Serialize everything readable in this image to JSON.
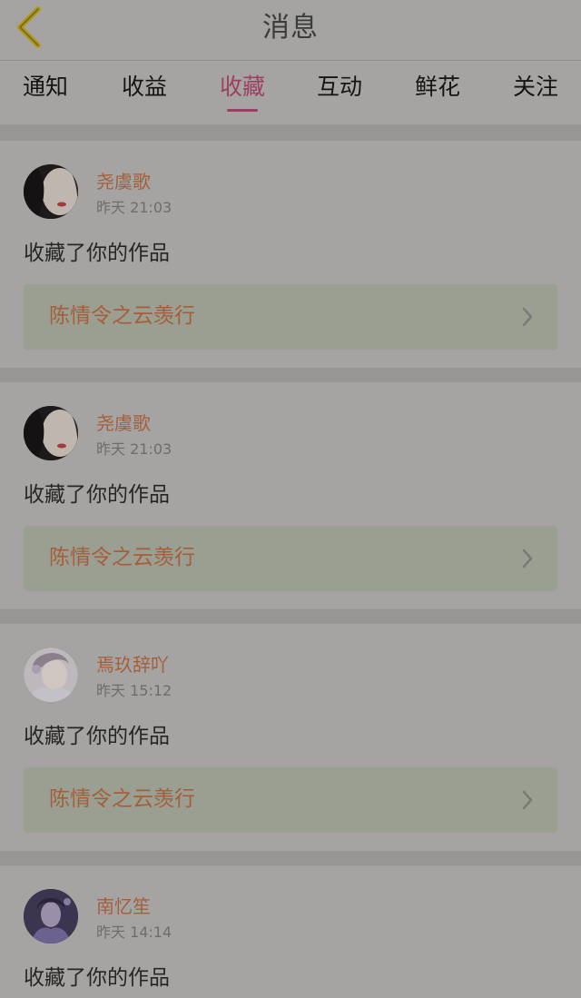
{
  "header": {
    "title": "消息"
  },
  "tabs": [
    {
      "label": "通知"
    },
    {
      "label": "收益"
    },
    {
      "label": "收藏",
      "active": true
    },
    {
      "label": "互动"
    },
    {
      "label": "鲜花"
    },
    {
      "label": "关注"
    }
  ],
  "messages": [
    {
      "username": "尧虞歌",
      "time": "昨天 21:03",
      "action": "收藏了你的作品",
      "work": "陈情令之云羡行"
    },
    {
      "username": "尧虞歌",
      "time": "昨天 21:03",
      "action": "收藏了你的作品",
      "work": "陈情令之云羡行"
    },
    {
      "username": "焉玖辞吖",
      "time": "昨天 15:12",
      "action": "收藏了你的作品",
      "work": "陈情令之云羡行"
    },
    {
      "username": "南忆笙",
      "time": "昨天 14:14",
      "action": "收藏了你的作品"
    }
  ],
  "colors": {
    "accent": "#9c3f63",
    "username": "#a65e3a",
    "work_card": "#9a9f92"
  },
  "icons": {
    "back": "chevron-left-icon",
    "link": "chevron-right-icon"
  }
}
